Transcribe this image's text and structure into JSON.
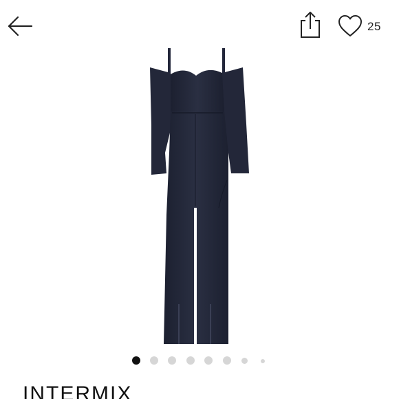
{
  "header": {
    "back_icon": "arrow-left-icon",
    "share_icon": "share-icon",
    "like_icon": "heart-icon",
    "like_count": "25"
  },
  "product": {
    "image_description_icon": "jumpsuit-image",
    "brand": "INTERMIX",
    "garment_color": "#242838"
  },
  "carousel": {
    "total_dots": 8,
    "active_index": 0,
    "active_color": "#111111",
    "inactive_color": "#d6d6d6"
  }
}
